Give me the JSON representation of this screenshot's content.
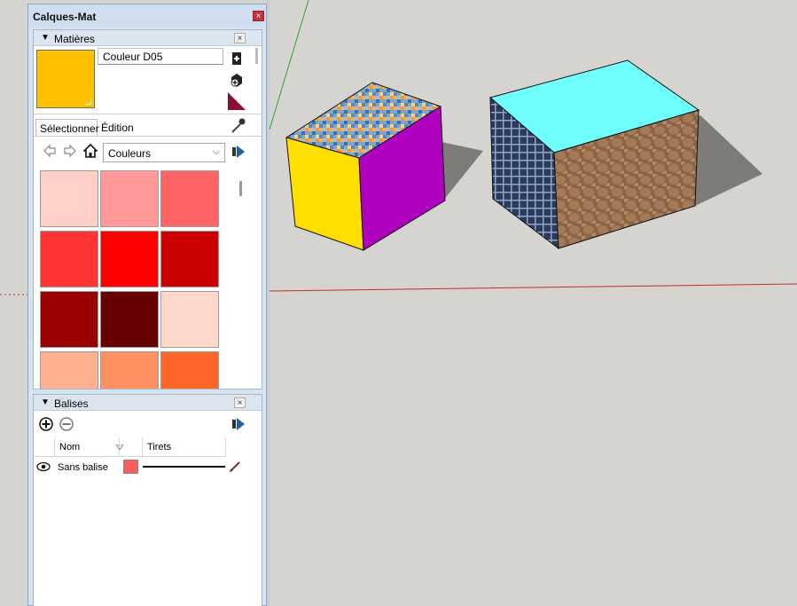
{
  "tray": {
    "title": "Calques-Mat",
    "close_glyph": "×"
  },
  "materials": {
    "header": "Matières",
    "collapse_glyph": "▼",
    "close_glyph": "×",
    "current_name": "Couleur D05",
    "current_color": "#ffc000",
    "tab_select": "Sélectionner",
    "tab_edit": "Édition",
    "library": "Couleurs",
    "library_chevron": "⌵",
    "swatches": [
      "#ffd0c8",
      "#ff9898",
      "#ff6464",
      "#ff3434",
      "#ff0000",
      "#cc0000",
      "#990000",
      "#660000",
      "#ffd8cc",
      "#ffb090",
      "#ff9060",
      "#ff6428"
    ]
  },
  "tags": {
    "header": "Balises",
    "collapse_glyph": "▼",
    "close_glyph": "×",
    "col_name": "Nom",
    "col_dash": "Tirets",
    "row_name": "Sans balise",
    "row_color": "#ff5c5c"
  },
  "icons": {
    "add": "add-icon",
    "remove": "remove-icon",
    "eye": "eye-icon",
    "pencil": "pencil-icon",
    "eyedropper": "eyedropper-icon",
    "home": "home-icon"
  }
}
